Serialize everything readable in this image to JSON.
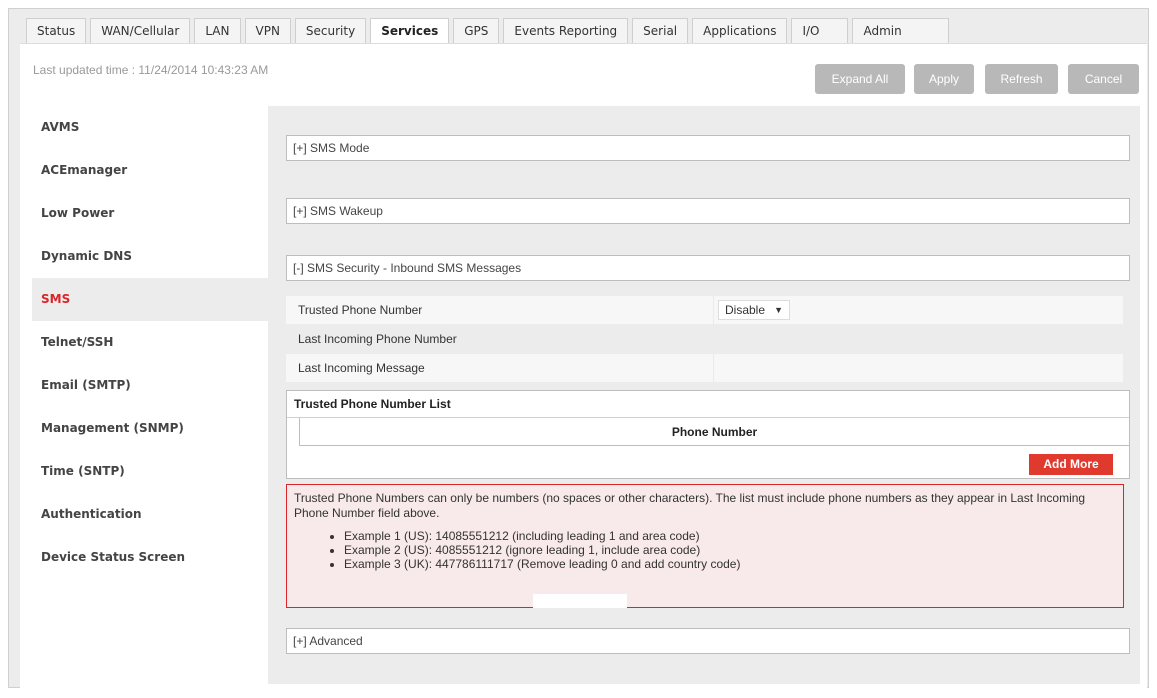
{
  "tabs": [
    "Status",
    "WAN/Cellular",
    "LAN",
    "VPN",
    "Security",
    "Services",
    "GPS",
    "Events Reporting",
    "Serial",
    "Applications",
    "I/O",
    "Admin"
  ],
  "active_tab": "Services",
  "last_updated": "Last updated time : 11/24/2014 10:43:23 AM",
  "toolbar": {
    "expand_all": "Expand All",
    "apply": "Apply",
    "refresh": "Refresh",
    "cancel": "Cancel"
  },
  "sidebar": [
    "AVMS",
    "ACEmanager",
    "Low Power",
    "Dynamic DNS",
    "SMS",
    "Telnet/SSH",
    "Email (SMTP)",
    "Management (SNMP)",
    "Time (SNTP)",
    "Authentication",
    "Device Status Screen"
  ],
  "active_sidebar": "SMS",
  "sections": {
    "sms_mode": "[+] SMS Mode",
    "sms_wakeup": "[+] SMS Wakeup",
    "sms_security": "[-] SMS Security - Inbound SMS Messages",
    "advanced": "[+] Advanced"
  },
  "fields": {
    "trusted_phone_number": "Trusted Phone Number",
    "trusted_phone_number_value": "Disable",
    "last_incoming_phone_number": "Last Incoming Phone Number",
    "last_incoming_message": "Last Incoming Message"
  },
  "trusted_list": {
    "title": "Trusted Phone Number List",
    "column": "Phone Number",
    "add_more": "Add More"
  },
  "note": {
    "text": "Trusted Phone Numbers can only be numbers (no spaces or other characters). The list must include phone numbers as they appear in Last Incoming Phone Number field above.",
    "examples": [
      "Example 1 (US): 14085551212 (including leading 1 and area code)",
      "Example 2 (US): 4085551212 (ignore leading 1, include area code)",
      "Example 3 (UK): 447786111717 (Remove leading 0 and add country code)"
    ]
  },
  "colors": {
    "accent_red": "#d9262b",
    "add_more_bg": "#e03a2e",
    "button_gray": "#b8b8b8"
  }
}
